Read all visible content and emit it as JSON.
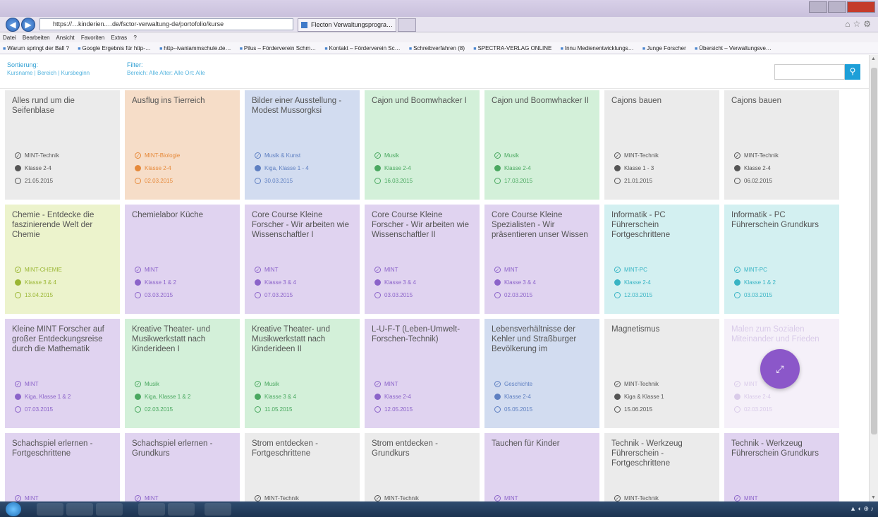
{
  "browser": {
    "url": "https://…kinderien.…de/fsctor-verwaltung-de/portofolio/kurse",
    "tab_active": "Flecton Verwaltungsprogra…",
    "menu": [
      "Datei",
      "Bearbeiten",
      "Ansicht",
      "Favoriten",
      "Extras",
      "?"
    ],
    "favorites": [
      "Warum springt der Ball ?",
      "Google Ergebnis für http-…",
      "http--ivanlammschule.de…",
      "Pilus – Förderverein Schm…",
      "Kontakt – Förderverein Sc…",
      "Schreibverfahren (8)",
      "SPECTRA-VERLAG ONLINE",
      "Innu Medienentwicklungs…",
      "Junge Forscher",
      "Übersicht – Verwaltungsve…"
    ]
  },
  "header": {
    "sort_label": "Sortierung:",
    "sort_options": "Kursname | Bereich | Kursbeginn",
    "filter_label": "Filter:",
    "filter_options": "Bereich: Alle  Alter: Alle  Ort: Alle",
    "search_placeholder": "",
    "search_icon": "search-icon"
  },
  "colors": {
    "accent": "#1d9fd8",
    "fab": "#8b57c9"
  },
  "courses": [
    {
      "title": "Alles rund um die Seifenblase",
      "area": "MINT-Technik",
      "class": "Klasse 2-4",
      "date": "21.05.2015",
      "color": "grey"
    },
    {
      "title": "Ausflug ins Tierreich",
      "area": "MINT-Biologie",
      "class": "Klasse 2-4",
      "date": "02.03.2015",
      "color": "orange"
    },
    {
      "title": "Bilder einer Ausstellung - Modest Mussorgksi",
      "area": "Musik & Kunst",
      "class": "Kiga, Klasse 1 - 4",
      "date": "30.03.2015",
      "color": "blue"
    },
    {
      "title": "Cajon und Boomwhacker I",
      "area": "Musik",
      "class": "Klasse 2-4",
      "date": "16.03.2015",
      "color": "green"
    },
    {
      "title": "Cajon und Boomwhacker II",
      "area": "Musik",
      "class": "Klasse 2-4",
      "date": "17.03.2015",
      "color": "green"
    },
    {
      "title": "Cajons bauen",
      "area": "MINT-Technik",
      "class": "Klasse 1 - 3",
      "date": "21.01.2015",
      "color": "grey"
    },
    {
      "title": "Cajons bauen",
      "area": "MINT-Technik",
      "class": "Klasse 2-4",
      "date": "06.02.2015",
      "color": "grey"
    },
    {
      "title": "Chemie - Entdecke die faszinierende Welt der Chemie",
      "area": "MINT-CHEMIE",
      "class": "Klasse 3 & 4",
      "date": "13.04.2015",
      "color": "lime"
    },
    {
      "title": "Chemielabor Küche",
      "area": "MINT",
      "class": "Klasse 1 & 2",
      "date": "03.03.2015",
      "color": "purple"
    },
    {
      "title": "Core Course Kleine Forscher - Wir arbeiten wie Wissenschaftler I",
      "area": "MINT",
      "class": "Klasse 3 & 4",
      "date": "07.03.2015",
      "color": "purple"
    },
    {
      "title": "Core Course Kleine Forscher - Wir arbeiten wie Wissenschaftler II",
      "area": "MINT",
      "class": "Klasse 3 & 4",
      "date": "03.03.2015",
      "color": "purple"
    },
    {
      "title": "Core Course Kleine Spezialisten - Wir präsentieren unser Wissen",
      "area": "MINT",
      "class": "Klasse 3 & 4",
      "date": "02.03.2015",
      "color": "purple"
    },
    {
      "title": "Informatik - PC Führerschein Fortgeschrittene",
      "area": "MINT-PC",
      "class": "Klasse 2-4",
      "date": "12.03.2015",
      "color": "cyan"
    },
    {
      "title": "Informatik - PC Führerschein Grundkurs",
      "area": "MINT-PC",
      "class": "Klasse 1 & 2",
      "date": "03.03.2015",
      "color": "cyan"
    },
    {
      "title": "Kleine MINT Forscher auf großer Entdeckungsreise durch die Mathematik",
      "area": "MINT",
      "class": "Kiga, Klasse 1 & 2",
      "date": "07.03.2015",
      "color": "purple"
    },
    {
      "title": "Kreative Theater- und Musikwerkstatt nach Kinderideen I",
      "area": "Musik",
      "class": "Kiga, Klasse 1 & 2",
      "date": "02.03.2015",
      "color": "green"
    },
    {
      "title": "Kreative Theater- und Musikwerkstatt nach Kinderideen II",
      "area": "Musik",
      "class": "Klasse 3 & 4",
      "date": "11.05.2015",
      "color": "green"
    },
    {
      "title": "L-U-F-T (Leben-Umwelt-Forschen-Technik)",
      "area": "MINT",
      "class": "Klasse 2-4",
      "date": "12.05.2015",
      "color": "purple"
    },
    {
      "title": "Lebensverhältnisse der Kehler und Straßburger Bevölkerung im",
      "area": "Geschichte",
      "class": "Klasse 2-4",
      "date": "05.05.2015",
      "color": "blue"
    },
    {
      "title": "Magnetismus",
      "area": "MINT-Technik",
      "class": "Kiga & Klasse 1",
      "date": "15.06.2015",
      "color": "grey"
    },
    {
      "title": "Malen zum Sozialen Miteinander und Frieden",
      "area": "MINT",
      "class": "Klasse 2-4",
      "date": "02.03.2015",
      "color": "faded"
    },
    {
      "title": "Schachspiel erlernen - Fortgeschrittene",
      "area": "MINT",
      "class": "",
      "date": "",
      "color": "purple"
    },
    {
      "title": "Schachspiel erlernen - Grundkurs",
      "area": "MINT",
      "class": "",
      "date": "",
      "color": "purple"
    },
    {
      "title": "Strom entdecken - Fortgeschrittene",
      "area": "MINT-Technik",
      "class": "",
      "date": "",
      "color": "grey"
    },
    {
      "title": "Strom entdecken - Grundkurs",
      "area": "MINT-Technik",
      "class": "",
      "date": "",
      "color": "grey"
    },
    {
      "title": "Tauchen für Kinder",
      "area": "MINT",
      "class": "",
      "date": "",
      "color": "purple"
    },
    {
      "title": "Technik - Werkzeug Führerschein - Fortgeschrittene",
      "area": "MINT-Technik",
      "class": "",
      "date": "",
      "color": "grey"
    },
    {
      "title": "Technik - Werkzeug Führerschein Grundkurs",
      "area": "MINT",
      "class": "",
      "date": "",
      "color": "purple"
    }
  ],
  "fab_icon": "expand-icon"
}
